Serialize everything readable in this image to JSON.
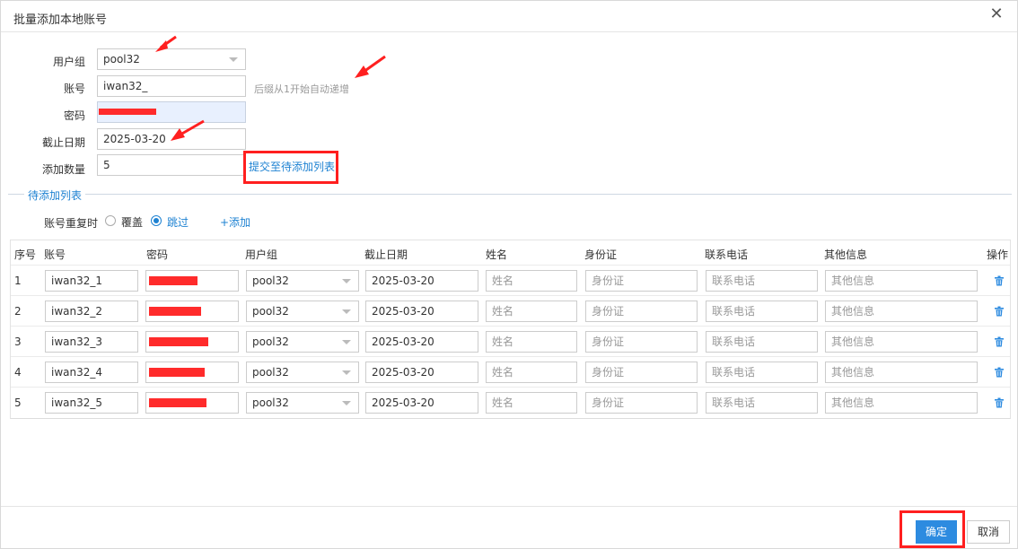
{
  "dialog": {
    "title": "批量添加本地账号",
    "close": "✕"
  },
  "form": {
    "group_label": "用户组",
    "group_value": "pool32",
    "account_label": "账号",
    "account_value": "iwan32_",
    "account_hint": "后缀从1开始自动递增",
    "password_label": "密码",
    "expire_label": "截止日期",
    "expire_value": "2025-03-20",
    "count_label": "添加数量",
    "count_value": "5",
    "submit_link": "提交至待添加列表"
  },
  "pending": {
    "section_title": "待添加列表",
    "dup_label": "账号重复时",
    "opt_overwrite": "覆盖",
    "opt_skip": "跳过",
    "selected": "跳过",
    "add_link": "+添加"
  },
  "table": {
    "headers": [
      "序号",
      "账号",
      "密码",
      "用户组",
      "截止日期",
      "姓名",
      "身份证",
      "联系电话",
      "其他信息",
      "操作"
    ],
    "placeholders": {
      "name": "姓名",
      "id": "身份证",
      "phone": "联系电话",
      "other": "其他信息"
    },
    "rows": [
      {
        "seq": "1",
        "account": "iwan32_1",
        "group": "pool32",
        "date": "2025-03-20"
      },
      {
        "seq": "2",
        "account": "iwan32_2",
        "group": "pool32",
        "date": "2025-03-20"
      },
      {
        "seq": "3",
        "account": "iwan32_3",
        "group": "pool32",
        "date": "2025-03-20"
      },
      {
        "seq": "4",
        "account": "iwan32_4",
        "group": "pool32",
        "date": "2025-03-20"
      },
      {
        "seq": "5",
        "account": "iwan32_5",
        "group": "pool32",
        "date": "2025-03-20"
      }
    ]
  },
  "footer": {
    "ok": "确定",
    "cancel": "取消"
  },
  "colors": {
    "accent": "#1e82d2",
    "primary_button": "#2d8be0",
    "annotation_red": "#ff1f1f"
  },
  "icons": {
    "close": "close-icon",
    "dropdown": "chevron-down-icon",
    "delete": "trash-icon",
    "annotation": "arrow-icon"
  }
}
